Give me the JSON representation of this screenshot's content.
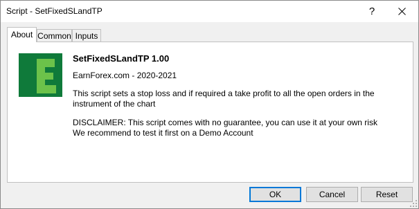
{
  "window": {
    "title": "Script - SetFixedSLandTP",
    "help_glyph": "?",
    "close_icon": "close-icon"
  },
  "tabs": [
    {
      "label": "About",
      "active": true
    },
    {
      "label": "Common",
      "active": false
    },
    {
      "label": "Inputs",
      "active": false
    }
  ],
  "about": {
    "logo_icon": "earnforex-logo",
    "logo_colors": {
      "dark": "#0f7a3a",
      "light": "#6cc24a"
    },
    "script_name": "SetFixedSLandTP 1.00",
    "copyright": "EarnForex.com - 2020-2021",
    "description": "This script sets a stop loss and if required a take profit to all the open orders in the instrument of the chart",
    "disclaimer_line1": "DISCLAIMER: This script comes with no guarantee, you can use it at your own risk",
    "disclaimer_line2": "We recommend to test it first on a Demo Account"
  },
  "buttons": {
    "ok": "OK",
    "cancel": "Cancel",
    "reset": "Reset"
  },
  "colors": {
    "accent": "#0078d7"
  }
}
